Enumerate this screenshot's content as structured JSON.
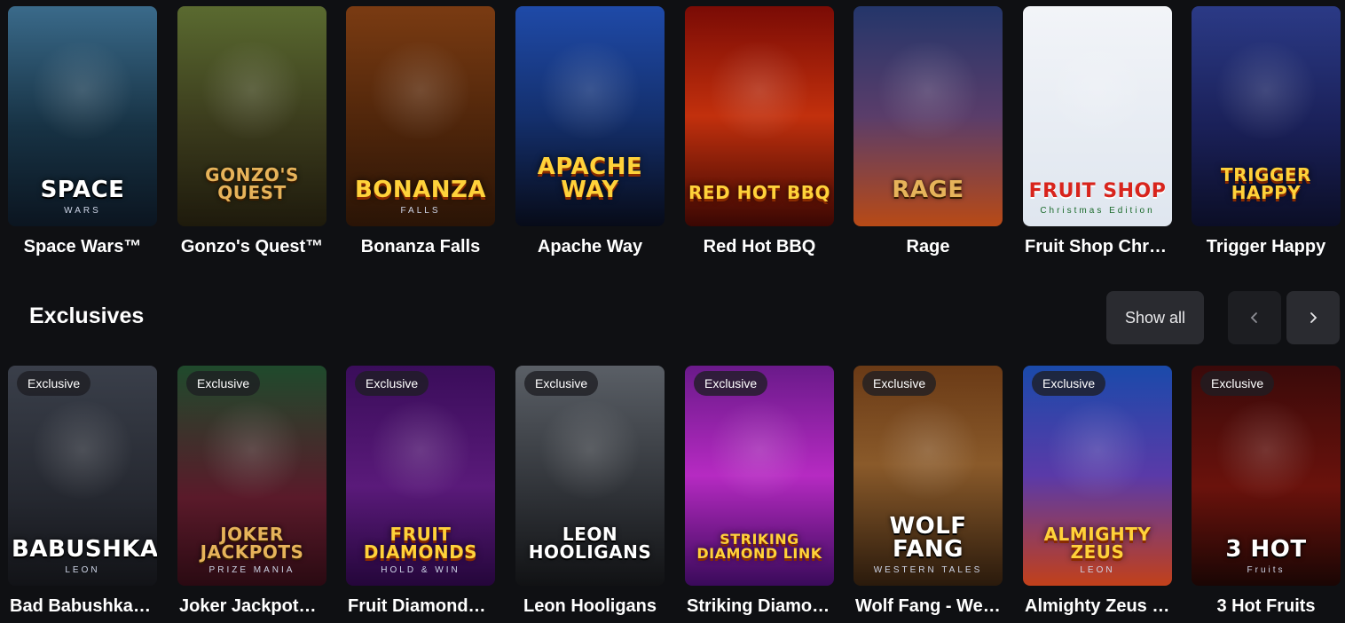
{
  "top_games": [
    {
      "label": "Space Wars™",
      "art": "SPACE",
      "art_sub": "WARS",
      "bg": "linear-gradient(180deg,#3a6a8a 0%,#173244 55%,#0b1520 100%)",
      "style": "white"
    },
    {
      "label": "Gonzo's Quest™",
      "art": "GONZO'S QUEST",
      "art_sub": "",
      "bg": "linear-gradient(180deg,#5a6a30 0%,#3a3a1c 55%,#1e1a0c 100%)",
      "style": "gold"
    },
    {
      "label": "Bonanza Falls",
      "art": "BONANZA",
      "art_sub": "FALLS",
      "bg": "linear-gradient(180deg,#7a3b12 0%,#4a230a 60%,#2a1406 100%)",
      "style": "yellow"
    },
    {
      "label": "Apache Way",
      "art": "APACHE WAY",
      "art_sub": "",
      "bg": "linear-gradient(180deg,#1f4aa8 0%,#14306e 50%,#070b18 100%)",
      "style": "yellow"
    },
    {
      "label": "Red Hot BBQ",
      "art": "RED HOT BBQ",
      "art_sub": "",
      "bg": "linear-gradient(180deg,#7a0b05 0%,#c2300d 50%,#3a0703 100%)",
      "style": "yellow"
    },
    {
      "label": "Rage",
      "art": "RAGE",
      "art_sub": "",
      "bg": "linear-gradient(180deg,#24366a 0%,#5a3d6a 50%,#b84a16 100%)",
      "style": "gold"
    },
    {
      "label": "Fruit Shop Christmas Edition",
      "art": "FRUIT SHOP",
      "art_sub": "Christmas Edition",
      "bg": "linear-gradient(180deg,#f2f4f8 0%,#dfe6ef 100%)",
      "style": "red"
    },
    {
      "label": "Trigger Happy",
      "art": "TRIGGER HAPPY",
      "art_sub": "",
      "bg": "linear-gradient(180deg,#2b3a86 0%,#1a2058 55%,#0b0e26 100%)",
      "style": "yellow"
    }
  ],
  "section": {
    "title": "Exclusives",
    "show_all": "Show all",
    "prev_icon": "chevron-left-icon",
    "next_icon": "chevron-right-icon"
  },
  "exclusive_games": [
    {
      "label": "Bad Babushkas Leon",
      "badge": "Exclusive",
      "art": "BABUSHKAS",
      "art_sub": "LEON",
      "bg": "linear-gradient(180deg,#3a3f4a 0%,#252830 60%,#121317 100%)",
      "style": "white"
    },
    {
      "label": "Joker Jackpots Prize Mania",
      "badge": "Exclusive",
      "art": "JOKER JACKPOTS",
      "art_sub": "PRIZE MANIA",
      "bg": "linear-gradient(180deg,#1f4a2c 0%,#5a1a2a 60%,#2a0a12 100%)",
      "style": "gold"
    },
    {
      "label": "Fruit Diamonds Hold & Win",
      "badge": "Exclusive",
      "art": "FRUIT DIAMONDS",
      "art_sub": "HOLD & WIN",
      "bg": "linear-gradient(180deg,#3a0d5a 0%,#5a1a7a 55%,#24063a 100%)",
      "style": "yellow"
    },
    {
      "label": "Leon Hooligans",
      "badge": "Exclusive",
      "art": "LEON HOOLIGANS",
      "art_sub": "",
      "bg": "linear-gradient(180deg,#5a5f66 0%,#2e3136 60%,#111214 100%)",
      "style": "white"
    },
    {
      "label": "Striking Diamond Link",
      "badge": "Exclusive",
      "art": "STRIKING DIAMOND LINK",
      "art_sub": "",
      "bg": "linear-gradient(180deg,#6a1a8a 0%,#b62ac2 50%,#3a0a5a 100%)",
      "style": "yellow"
    },
    {
      "label": "Wolf Fang - Western Tales",
      "badge": "Exclusive",
      "art": "WOLF FANG",
      "art_sub": "WESTERN TALES",
      "bg": "linear-gradient(180deg,#6a3a16 0%,#8a5a2a 45%,#2a1a0c 100%)",
      "style": "white"
    },
    {
      "label": "Almighty Zeus Leon",
      "badge": "Exclusive",
      "art": "ALMIGHTY ZEUS",
      "art_sub": "LEON",
      "bg": "linear-gradient(180deg,#1a4aaa 0%,#5a3aa8 50%,#c2401a 100%)",
      "style": "yellow"
    },
    {
      "label": "3 Hot Fruits",
      "badge": "Exclusive",
      "art": "3 HOT",
      "art_sub": "Fruits",
      "bg": "linear-gradient(180deg,#3a0a0a 0%,#6a120c 55%,#1a0604 100%)",
      "style": "white"
    }
  ]
}
